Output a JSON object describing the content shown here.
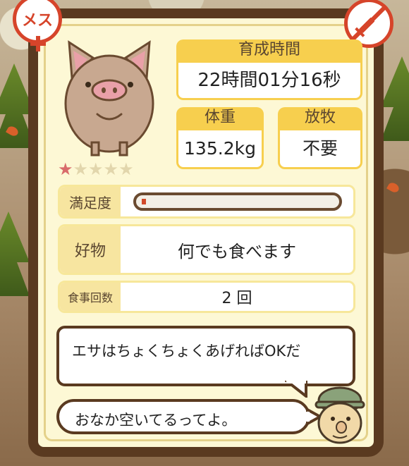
{
  "badges": {
    "gender_text": "メス",
    "gender_icon": "female-icon",
    "syringe_icon": "syringe-icon",
    "accent": "#d6442a"
  },
  "rating": {
    "filled": 1,
    "total": 5
  },
  "growth": {
    "title": "育成時間",
    "value": "22時間01分16秒"
  },
  "weight": {
    "title": "体重",
    "value": "135.2kg"
  },
  "grazing": {
    "title": "放牧",
    "value": "不要"
  },
  "satisfaction": {
    "label": "満足度",
    "level": 0.02
  },
  "favorite": {
    "label": "好物",
    "value": "何でも食べます"
  },
  "meals": {
    "label": "食事回数",
    "value": "2 回"
  },
  "messages": {
    "tip": "エサはちょくちょくあげればOKだ",
    "status": "おなか空いてるってよ。"
  },
  "colors": {
    "frame": "#5a3a20",
    "panel": "#fdf8d5",
    "header": "#f7cf4e"
  }
}
